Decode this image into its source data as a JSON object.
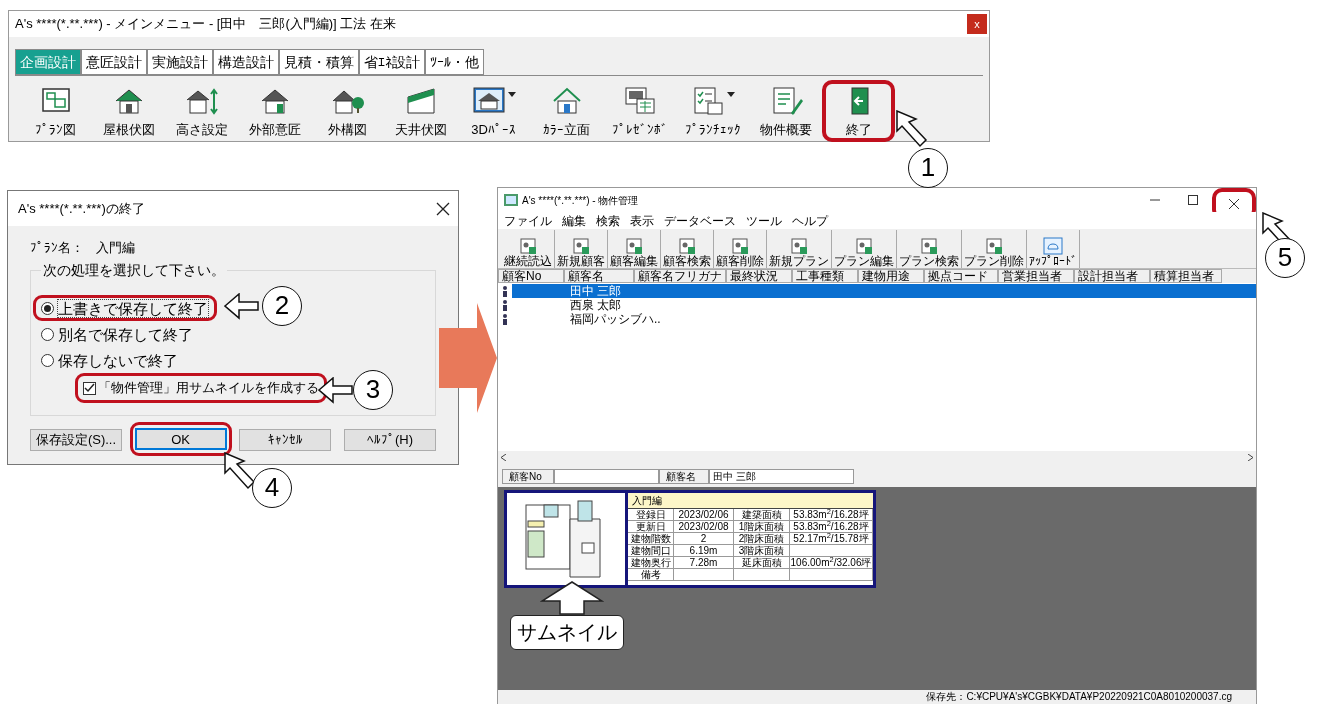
{
  "main_window": {
    "title": "A's ****(*.**.***) - メインメニュー - [田中　三郎(入門編)]  工法 在来",
    "close": "x",
    "tabs": [
      {
        "label": "企画設計",
        "selected": true
      },
      {
        "label": "意匠設計",
        "selected": false
      },
      {
        "label": "実施設計",
        "selected": false
      },
      {
        "label": "構造設計",
        "selected": false
      },
      {
        "label": "見積・積算",
        "selected": false
      },
      {
        "label": "省ｴﾈ設計",
        "selected": false
      },
      {
        "label": "ﾂｰﾙ・他",
        "selected": false
      }
    ],
    "tools": [
      {
        "label": "ﾌﾟﾗﾝ図",
        "dropdown": false
      },
      {
        "label": "屋根伏図",
        "dropdown": false
      },
      {
        "label": "高さ設定",
        "dropdown": false
      },
      {
        "label": "外部意匠",
        "dropdown": false
      },
      {
        "label": "外構図",
        "dropdown": false
      },
      {
        "label": "天井伏図",
        "dropdown": false
      },
      {
        "label": "3Dﾊﾟｰｽ",
        "dropdown": true
      },
      {
        "label": "ｶﾗｰ立面",
        "dropdown": false
      },
      {
        "label": "ﾌﾟﾚｾﾞﾝﾎﾞ",
        "dropdown": false
      },
      {
        "label": "ﾌﾟﾗﾝﾁｪｯｸ",
        "dropdown": true
      },
      {
        "label": "物件概要",
        "dropdown": false
      },
      {
        "label": "終了",
        "dropdown": false,
        "highlighted": true
      }
    ]
  },
  "dialog": {
    "title": "A's ****(*.**.***)の終了",
    "plan_label": "ﾌﾟﾗﾝ名：",
    "plan_name": "入門編",
    "group_label": "次の処理を選択して下さい。",
    "options": [
      {
        "label": "上書きで保存して終了",
        "selected": true,
        "highlighted": true
      },
      {
        "label": "別名で保存して終了",
        "selected": false,
        "highlighted": false
      },
      {
        "label": "保存しないで終了",
        "selected": false,
        "highlighted": false
      }
    ],
    "thumbnail_checkbox": {
      "label": "「物件管理」用サムネイルを作成する",
      "checked": true,
      "highlighted": true
    },
    "buttons": [
      {
        "label": "保存設定(S)...",
        "default": false,
        "highlighted": false
      },
      {
        "label": "OK",
        "default": true,
        "highlighted": true
      },
      {
        "label": "ｷｬﾝｾﾙ",
        "default": false,
        "highlighted": false
      },
      {
        "label": "ﾍﾙﾌﾟ(H)",
        "default": false,
        "highlighted": false
      }
    ]
  },
  "property_window": {
    "title": "A's ****(*.**.***) - 物件管理",
    "close_highlighted": true,
    "menu": [
      "ファイル",
      "編集",
      "検索",
      "表示",
      "データベース",
      "ツール",
      "ヘルプ"
    ],
    "toolbar": [
      "継続読込",
      "新規顧客",
      "顧客編集",
      "顧客検索",
      "顧客削除",
      "新規プラン",
      "プラン編集",
      "プラン検索",
      "プラン削除",
      "ｱｯﾌﾟﾛｰﾄﾞ"
    ],
    "columns": [
      "顧客No",
      "顧客名",
      "顧客名フリガナ",
      "最終状況",
      "工事種類",
      "建物用途",
      "拠点コード",
      "営業担当者",
      "設計担当者",
      "積算担当者"
    ],
    "rows": [
      {
        "name": "田中 三郎",
        "selected": true
      },
      {
        "name": "西泉 太郎",
        "selected": false
      },
      {
        "name": "福岡パッシブハ..",
        "selected": false
      }
    ],
    "customer_no_label": "顧客No",
    "customer_name_label": "顧客名",
    "customer_name": "田中 三郎",
    "thumbnail_card": {
      "title": "入門編",
      "rows": [
        [
          "登録日",
          "2023/02/06",
          "建築面積",
          "53.83m$^{2}$/16.28坪"
        ],
        [
          "更新日",
          "2023/02/08",
          "1階床面積",
          "53.83m$^{2}$/16.28坪"
        ],
        [
          "建物階数",
          "2",
          "2階床面積",
          "52.17m$^{2}$/15.78坪"
        ],
        [
          "建物間口",
          "6.19m",
          "3階床面積",
          ""
        ],
        [
          "建物奥行",
          "7.28m",
          "延床面積",
          "106.00m$^{2}$/32.06坪"
        ],
        [
          "備考",
          "",
          "",
          ""
        ]
      ]
    },
    "status": "保存先：C:¥CPU¥A's¥CGBK¥DATA¥P20220921C0A8010200037.cg"
  },
  "thumbnail_caption": "サムネイル",
  "callouts": [
    "1",
    "2",
    "3",
    "4",
    "5"
  ]
}
